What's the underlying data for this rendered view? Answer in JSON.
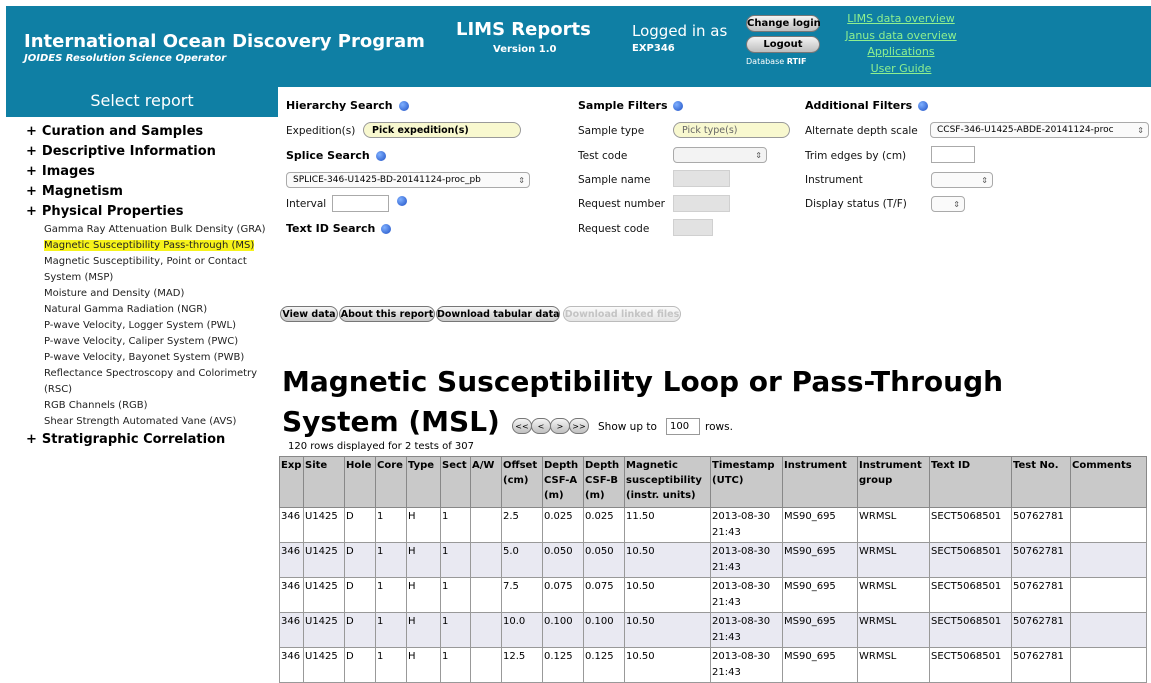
{
  "header": {
    "org_title": "International Ocean Discovery Program",
    "org_subtitle": "JOIDES Resolution Science Operator",
    "app_title": "LIMS Reports",
    "app_version": "Version 1.0",
    "logged_in_label": "Logged in as",
    "logged_in_user": "EXP346",
    "change_login_button": "Change login",
    "logout_button": "Logout",
    "database_label": "Database",
    "database_value": "RTIF",
    "links": [
      "LIMS data overview",
      "Janus data overview",
      "Applications",
      "User Guide"
    ]
  },
  "sidebar": {
    "heading": "Select report",
    "categories": [
      {
        "label": "Curation and Samples"
      },
      {
        "label": "Descriptive Information"
      },
      {
        "label": "Images"
      },
      {
        "label": "Magnetism"
      },
      {
        "label": "Physical Properties"
      }
    ],
    "physical_properties_items": [
      "Gamma Ray Attenuation Bulk Density (GRA)",
      "Magnetic Susceptibility Pass-through (MS)",
      "Magnetic Susceptibility, Point or Contact System (MSP)",
      "Moisture and Density (MAD)",
      "Natural Gamma Radiation (NGR)",
      "P-wave Velocity, Logger System (PWL)",
      "P-wave Velocity, Caliper System (PWC)",
      "P-wave Velocity, Bayonet System (PWB)",
      "Reflectance Spectroscopy and Colorimetry (RSC)",
      "RGB Channels (RGB)",
      "Shear Strength Automated Vane (AVS)"
    ],
    "selected_item": "Magnetic Susceptibility Pass-through (MS)",
    "last_category": "Stratigraphic Correlation"
  },
  "filters": {
    "hierarchy_heading": "Hierarchy Search",
    "expedition_label": "Expedition(s)",
    "expedition_value": "Pick expedition(s)",
    "splice_heading": "Splice Search",
    "splice_value": "SPLICE-346-U1425-BD-20141124-proc_pb",
    "interval_label": "Interval",
    "text_id_heading": "Text ID Search",
    "sample_heading": "Sample Filters",
    "sample_type_label": "Sample type",
    "sample_type_value": "Pick type(s)",
    "test_code_label": "Test code",
    "sample_name_label": "Sample name",
    "request_number_label": "Request number",
    "request_code_label": "Request code",
    "additional_heading": "Additional Filters",
    "alt_depth_label": "Alternate depth scale",
    "alt_depth_value": "CCSF-346-U1425-ABDE-20141124-proc",
    "trim_label": "Trim edges by (cm)",
    "instrument_label": "Instrument",
    "display_status_label": "Display status (T/F)"
  },
  "actions": {
    "view_data": "View data",
    "about": "About this report",
    "download_tabular": "Download tabular data",
    "download_linked": "Download linked files"
  },
  "report": {
    "title": "Magnetic Susceptibility Loop or Pass-Through System (MSL)",
    "pager_buttons": [
      "<<",
      "<",
      ">",
      ">>"
    ],
    "show_up_to": "Show up to",
    "rows_value": "100",
    "rows_word": "rows.",
    "rows_info": "120 rows displayed for 2 tests of 307"
  },
  "table": {
    "columns": [
      "Exp",
      "Site",
      "Hole",
      "Core",
      "Type",
      "Sect",
      "A/W",
      "Offset (cm)",
      "Depth CSF-A (m)",
      "Depth CSF-B (m)",
      "Magnetic susceptibility (instr. units)",
      "Timestamp (UTC)",
      "Instrument",
      "Instrument group",
      "Text ID",
      "Test No.",
      "Comments"
    ],
    "rows": [
      [
        "346",
        "U1425",
        "D",
        "1",
        "H",
        "1",
        "",
        "2.5",
        "0.025",
        "0.025",
        "11.50",
        "2013-08-30 21:43",
        "MS90_695",
        "WRMSL",
        "SECT5068501",
        "50762781",
        ""
      ],
      [
        "346",
        "U1425",
        "D",
        "1",
        "H",
        "1",
        "",
        "5.0",
        "0.050",
        "0.050",
        "10.50",
        "2013-08-30 21:43",
        "MS90_695",
        "WRMSL",
        "SECT5068501",
        "50762781",
        ""
      ],
      [
        "346",
        "U1425",
        "D",
        "1",
        "H",
        "1",
        "",
        "7.5",
        "0.075",
        "0.075",
        "10.50",
        "2013-08-30 21:43",
        "MS90_695",
        "WRMSL",
        "SECT5068501",
        "50762781",
        ""
      ],
      [
        "346",
        "U1425",
        "D",
        "1",
        "H",
        "1",
        "",
        "10.0",
        "0.100",
        "0.100",
        "10.50",
        "2013-08-30 21:43",
        "MS90_695",
        "WRMSL",
        "SECT5068501",
        "50762781",
        ""
      ],
      [
        "346",
        "U1425",
        "D",
        "1",
        "H",
        "1",
        "",
        "12.5",
        "0.125",
        "0.125",
        "10.50",
        "2013-08-30 21:43",
        "MS90_695",
        "WRMSL",
        "SECT5068501",
        "50762781",
        ""
      ]
    ]
  },
  "colors": {
    "header_bg": "#0f7fa4",
    "link_green": "#8ff08f",
    "highlight_yellow": "#f7f31a",
    "table_header_bg": "#c9c9c9",
    "table_alt_row": "#e9e9f2"
  }
}
